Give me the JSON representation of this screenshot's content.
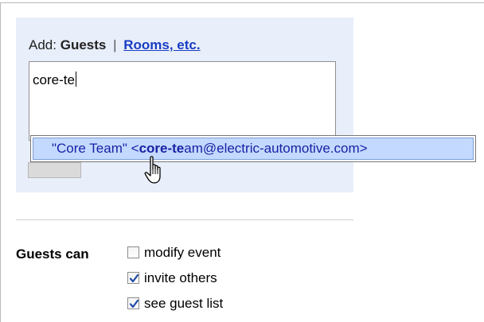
{
  "add_section": {
    "add_label": "Add:",
    "guests_label": "Guests",
    "separator": "|",
    "rooms_link": "Rooms, etc.",
    "input_value": "core-te"
  },
  "suggestion": {
    "prefix": "\"Core Team\" <",
    "bold_match": "core-te",
    "remainder": "am@electric-automotive.com>"
  },
  "permissions": {
    "label": "Guests can",
    "options": [
      {
        "label": "modify event",
        "checked": false,
        "icon": "checkbox-unchecked"
      },
      {
        "label": "invite others",
        "checked": true,
        "icon": "checkbox-checked"
      },
      {
        "label": "see guest list",
        "checked": true,
        "icon": "checkbox-checked"
      }
    ]
  },
  "colors": {
    "panel_background": "#e8eefa",
    "link": "#1a3ec2",
    "suggestion_highlight": "#c3d9ff",
    "suggestion_text": "#1a1fa3",
    "checkmark": "#1f4aa8"
  }
}
